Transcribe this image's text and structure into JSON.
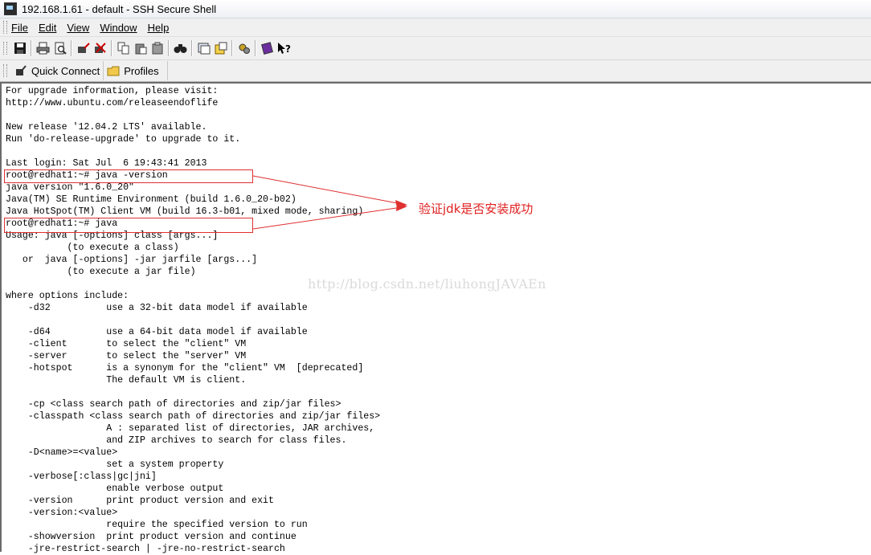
{
  "window": {
    "title": "192.168.1.61 - default - SSH Secure Shell"
  },
  "menu": [
    {
      "label": "File"
    },
    {
      "label": "Edit"
    },
    {
      "label": "View"
    },
    {
      "label": "Window"
    },
    {
      "label": "Help"
    }
  ],
  "toolbar_icons": [
    "save-icon",
    "print-icon",
    "print-preview-icon",
    "quick-connect-icon",
    "disconnect-icon",
    "copy-icon",
    "paste-icon",
    "paste-alt-icon",
    "find-icon",
    "new-terminal-icon",
    "file-transfer-icon",
    "settings-icon",
    "help-book-icon",
    "context-help-icon"
  ],
  "quickbar": {
    "quick_connect": "Quick Connect",
    "profiles": "Profiles"
  },
  "terminal": {
    "lines": [
      "For upgrade information, please visit:",
      "http://www.ubuntu.com/releaseendoflife",
      "",
      "New release '12.04.2 LTS' available.",
      "Run 'do-release-upgrade' to upgrade to it.",
      "",
      "Last login: Sat Jul  6 19:43:41 2013",
      "root@redhat1:~# java -version",
      "java version \"1.6.0_20\"",
      "Java(TM) SE Runtime Environment (build 1.6.0_20-b02)",
      "Java HotSpot(TM) Client VM (build 16.3-b01, mixed mode, sharing)",
      "root@redhat1:~# java",
      "Usage: java [-options] class [args...]",
      "           (to execute a class)",
      "   or  java [-options] -jar jarfile [args...]",
      "           (to execute a jar file)",
      "",
      "where options include:",
      "    -d32          use a 32-bit data model if available",
      "",
      "    -d64          use a 64-bit data model if available",
      "    -client       to select the \"client\" VM",
      "    -server       to select the \"server\" VM",
      "    -hotspot      is a synonym for the \"client\" VM  [deprecated]",
      "                  The default VM is client.",
      "",
      "    -cp <class search path of directories and zip/jar files>",
      "    -classpath <class search path of directories and zip/jar files>",
      "                  A : separated list of directories, JAR archives,",
      "                  and ZIP archives to search for class files.",
      "    -D<name>=<value>",
      "                  set a system property",
      "    -verbose[:class|gc|jni]",
      "                  enable verbose output",
      "    -version      print product version and exit",
      "    -version:<value>",
      "                  require the specified version to run",
      "    -showversion  print product version and continue",
      "    -jre-restrict-search | -jre-no-restrict-search"
    ]
  },
  "annotation": {
    "label": "验证jdk是否安装成功",
    "color": "#e02020"
  },
  "watermark": "http://blog.csdn.net/liuhongJAVAEn"
}
